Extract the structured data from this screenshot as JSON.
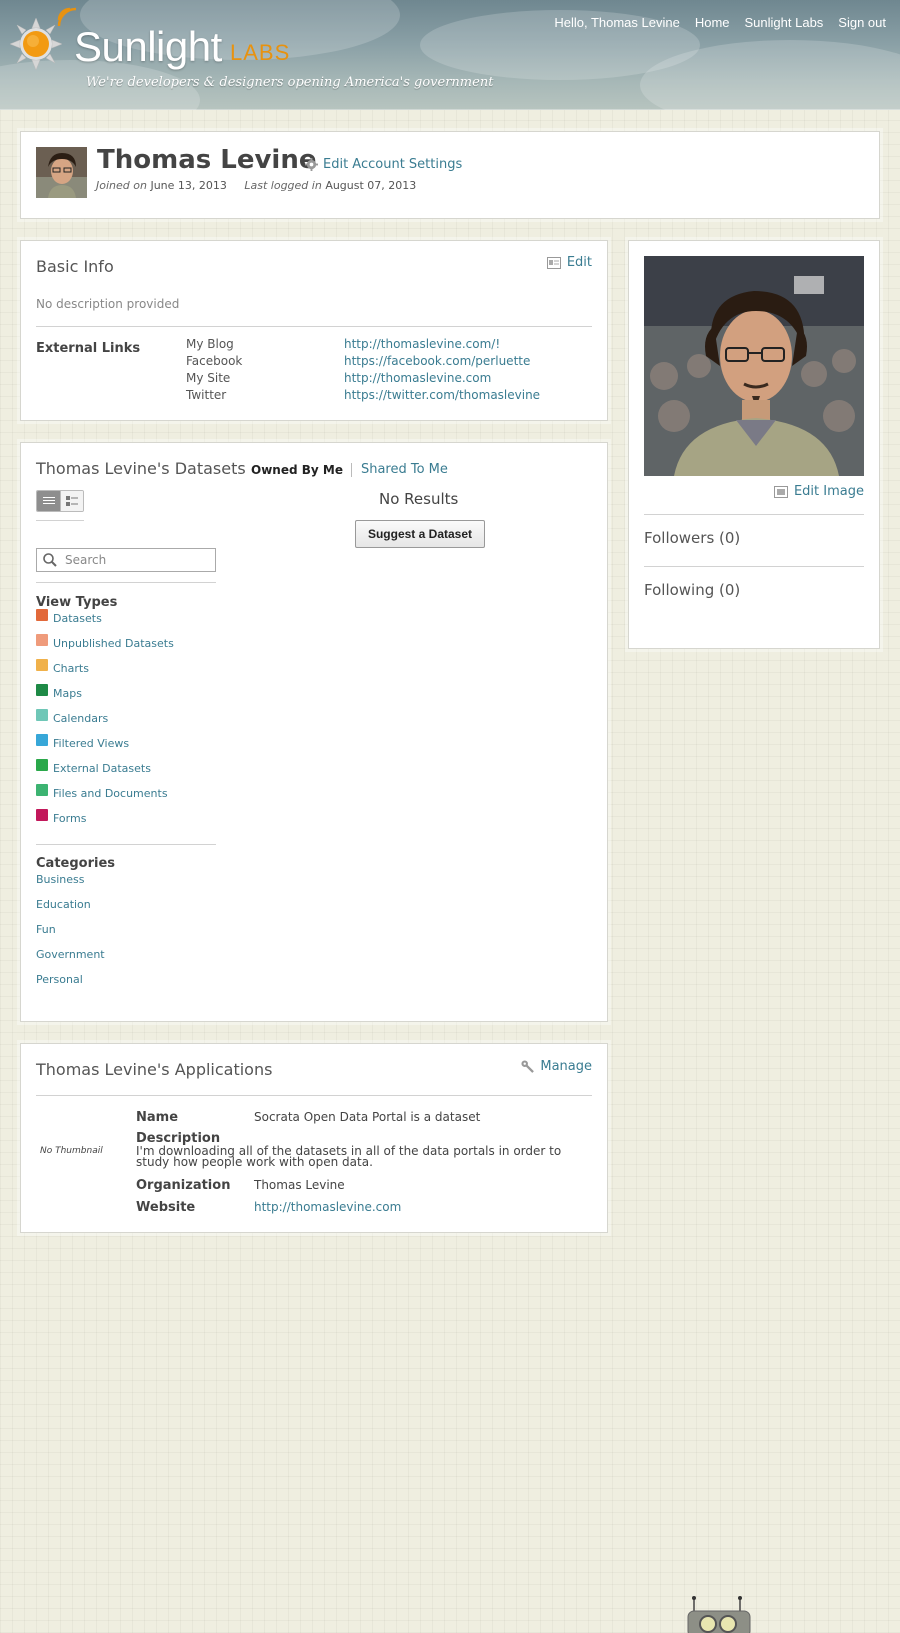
{
  "header": {
    "brand": "Sunlight",
    "brand_suffix": "LABS",
    "tagline": "We're developers & designers opening America's government",
    "nav": [
      {
        "label": "Hello, Thomas Levine"
      },
      {
        "label": "Home"
      },
      {
        "label": "Sunlight Labs"
      },
      {
        "label": "Sign out"
      }
    ]
  },
  "profile": {
    "name": "Thomas Levine",
    "edit_settings": "Edit Account Settings",
    "joined_label": "Joined on",
    "joined_date": "June 13, 2013",
    "last_login_label": "Last logged in",
    "last_login_date": "August 07, 2013"
  },
  "basic_info": {
    "title": "Basic Info",
    "edit": "Edit",
    "description": "No description provided",
    "links_label": "External Links",
    "links": [
      {
        "name": "My Blog",
        "url": "http://thomaslevine.com/!"
      },
      {
        "name": "Facebook",
        "url": "https://facebook.com/perluette"
      },
      {
        "name": "My Site",
        "url": "http://thomaslevine.com"
      },
      {
        "name": "Twitter",
        "url": "https://twitter.com/thomaslevine"
      }
    ]
  },
  "datasets": {
    "title": "Thomas Levine's Datasets",
    "tab_owned": "Owned By Me",
    "tab_shared": "Shared To Me",
    "search_placeholder": "Search",
    "no_results": "No Results",
    "suggest": "Suggest a Dataset",
    "view_types_title": "View Types",
    "view_types": [
      {
        "label": "Datasets",
        "color": "#e2693a"
      },
      {
        "label": "Unpublished Datasets",
        "color": "#ef9b7b"
      },
      {
        "label": "Charts",
        "color": "#f0b14a"
      },
      {
        "label": "Maps",
        "color": "#1e8a46"
      },
      {
        "label": "Calendars",
        "color": "#6fc7b7"
      },
      {
        "label": "Filtered Views",
        "color": "#37a7d8"
      },
      {
        "label": "External Datasets",
        "color": "#2aa84a"
      },
      {
        "label": "Files and Documents",
        "color": "#3cb371"
      },
      {
        "label": "Forms",
        "color": "#c2185b"
      }
    ],
    "categories_title": "Categories",
    "categories": [
      "Business",
      "Education",
      "Fun",
      "Government",
      "Personal"
    ]
  },
  "applications": {
    "title": "Thomas Levine's Applications",
    "manage": "Manage",
    "thumbnail": "No Thumbnail",
    "name_label": "Name",
    "name": "Socrata Open Data Portal is a dataset",
    "description_label": "Description",
    "description": "I'm downloading all of the datasets in all of the data portals in order to study how people work with open data.",
    "organization_label": "Organization",
    "organization": "Thomas Levine",
    "website_label": "Website",
    "website": "http://thomaslevine.com"
  },
  "side": {
    "edit_image": "Edit Image",
    "followers": "Followers (0)",
    "following": "Following (0)"
  },
  "colors": {
    "link": "#3a7c91",
    "brand_orange": "#e8920f",
    "background": "#efeee0"
  }
}
